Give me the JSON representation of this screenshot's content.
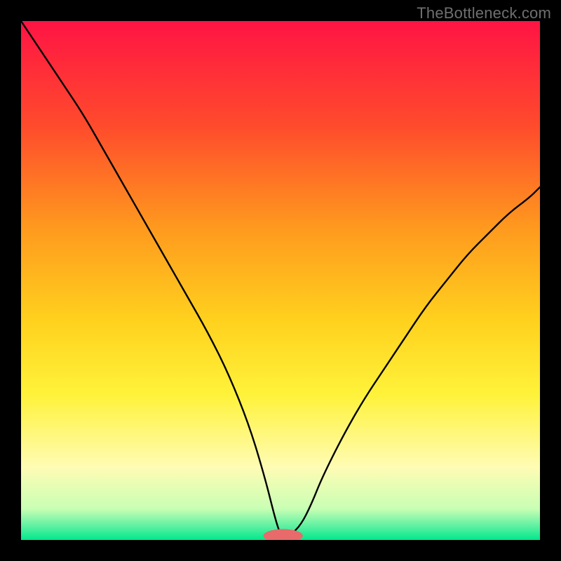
{
  "watermark": "TheBottleneck.com",
  "chart_data": {
    "type": "line",
    "title": "",
    "xlabel": "",
    "ylabel": "",
    "xlim": [
      0,
      100
    ],
    "ylim": [
      0,
      100
    ],
    "legend": false,
    "grid": false,
    "annotations": [],
    "background_gradient_stops": [
      {
        "pos": 0.0,
        "color": "#ff1444"
      },
      {
        "pos": 0.2,
        "color": "#ff4a2c"
      },
      {
        "pos": 0.4,
        "color": "#ff9a1e"
      },
      {
        "pos": 0.58,
        "color": "#ffd21e"
      },
      {
        "pos": 0.72,
        "color": "#fff23a"
      },
      {
        "pos": 0.86,
        "color": "#fffcb4"
      },
      {
        "pos": 0.94,
        "color": "#c8ffb4"
      },
      {
        "pos": 0.975,
        "color": "#58f0a0"
      },
      {
        "pos": 1.0,
        "color": "#00e88c"
      }
    ],
    "series": [
      {
        "name": "bottleneck-curve",
        "color": "#000000",
        "x": [
          0,
          4,
          8,
          12,
          16,
          20,
          24,
          28,
          32,
          36,
          40,
          44,
          47,
          49,
          50,
          51,
          52,
          54,
          56,
          58,
          62,
          66,
          70,
          74,
          78,
          82,
          86,
          90,
          94,
          98,
          100
        ],
        "y": [
          100,
          94,
          88,
          82,
          75,
          68,
          61,
          54,
          47,
          40,
          32,
          22,
          12,
          4,
          1,
          0,
          1,
          3,
          7,
          12,
          20,
          27,
          33,
          39,
          45,
          50,
          55,
          59,
          63,
          66,
          68
        ]
      }
    ],
    "marker": {
      "name": "optimal-marker",
      "color": "#e86a6a",
      "x": 50.5,
      "y": 0.8,
      "rx": 3.8,
      "ry": 1.3
    }
  }
}
